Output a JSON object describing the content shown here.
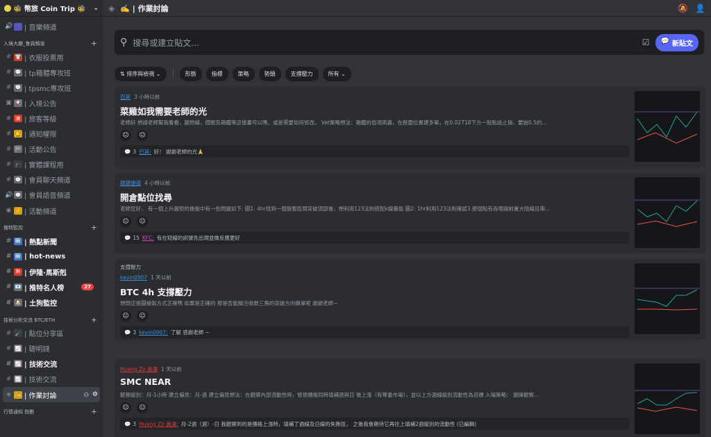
{
  "server": {
    "name": "🐝 幣旅 Coin Trip 🐝"
  },
  "channel_title": "✍️ | 作業討論",
  "sidebar": {
    "items": [
      {
        "kind": "ch",
        "icon": "speaker-icon",
        "icg": "🔊",
        "emoji": "🎵",
        "emc": "#5a4fcf",
        "label": "| 音樂頻道"
      },
      {
        "kind": "cat",
        "label": "入境大廳_會員頻道",
        "cname": "category-members"
      },
      {
        "kind": "ch",
        "icon": "hash-icon",
        "icg": "#",
        "emoji": "👕",
        "emc": "#c8412a",
        "label": "| 衣服投票用"
      },
      {
        "kind": "ch",
        "icon": "hash-icon",
        "icg": "#",
        "emoji": "💬",
        "emc": "#6d6f78",
        "label": "| tp箱體專攻班"
      },
      {
        "kind": "ch",
        "icon": "hash-icon",
        "icg": "#",
        "emoji": "💬",
        "emc": "#6d6f78",
        "label": "| tpsmc專攻班"
      },
      {
        "kind": "ch",
        "icon": "announcement-icon",
        "icg": "▣",
        "emoji": "📢",
        "emc": "#6d6f78",
        "label": "| 入境公告"
      },
      {
        "kind": "ch",
        "icon": "hash-icon",
        "icg": "#",
        "emoji": "🈵",
        "emc": "#c8412a",
        "label": "| 旅客等級"
      },
      {
        "kind": "ch",
        "icon": "hash-icon",
        "icg": "#",
        "emoji": "🔔",
        "emc": "#d4a017",
        "label": "| 通知權限"
      },
      {
        "kind": "ch",
        "icon": "hash-icon",
        "icg": "#",
        "emoji": "🏁",
        "emc": "#6d6f78",
        "label": "| 活動公告"
      },
      {
        "kind": "ch",
        "icon": "hash-icon",
        "icg": "#",
        "emoji": "🎓",
        "emc": "#3b3d44",
        "label": "| 實體課程用"
      },
      {
        "kind": "ch",
        "icon": "hash-icon",
        "icg": "#",
        "emoji": "💬",
        "emc": "#6d6f78",
        "label": "| 會員聊天頻道"
      },
      {
        "kind": "ch",
        "icon": "speaker-icon",
        "icg": "🔊",
        "emoji": "💬",
        "emc": "#6d6f78",
        "label": "| 會員語音頻道"
      },
      {
        "kind": "ch",
        "icon": "stage-icon",
        "icg": "◉",
        "emoji": "✌️",
        "emc": "#d4a017",
        "label": "| 活動頻道"
      },
      {
        "kind": "cat",
        "label": "推特監控",
        "cname": "category-twitter"
      },
      {
        "kind": "ch",
        "icon": "hash-icon",
        "icg": "#",
        "emoji": "🆕",
        "emc": "#3b6fd4",
        "label": "| 熱點新聞",
        "bold": true
      },
      {
        "kind": "ch",
        "icon": "hash-icon",
        "icg": "#",
        "emoji": "🆕",
        "emc": "#3b6fd4",
        "label": "| hot-news",
        "bold": true
      },
      {
        "kind": "ch",
        "icon": "hash-icon",
        "icg": "#",
        "emoji": "🈹",
        "emc": "#c8412a",
        "label": "| 伊隆·馬斯剋",
        "bold": true
      },
      {
        "kind": "ch",
        "icon": "hash-icon",
        "icg": "#",
        "emoji": "📧",
        "emc": "#6d6f78",
        "label": "| 推特名人榜",
        "bold": true,
        "badge": "27"
      },
      {
        "kind": "ch",
        "icon": "hash-icon",
        "icg": "#",
        "emoji": "🐶",
        "emc": "#6d6f78",
        "label": "| 土狗監控",
        "bold": true
      },
      {
        "kind": "cat",
        "label": "技術分析交流 BTC/ETH",
        "cname": "category-ta"
      },
      {
        "kind": "ch",
        "icon": "hash-icon",
        "icg": "#",
        "emoji": "🖌️",
        "emc": "#3b3d44",
        "label": "| 點位分享區"
      },
      {
        "kind": "ch",
        "icon": "hash-icon",
        "icg": "#",
        "emoji": "📈",
        "emc": "#6d6f78",
        "label": "| 聰明錢"
      },
      {
        "kind": "ch",
        "icon": "hash-icon",
        "icg": "#",
        "emoji": "📈",
        "emc": "#6d6f78",
        "label": "| 技術交流",
        "bold": true
      },
      {
        "kind": "ch",
        "icon": "hash-icon",
        "icg": "#",
        "emoji": "📈",
        "emc": "#6d6f78",
        "label": "| 技術交流"
      },
      {
        "kind": "ch",
        "icon": "forum-icon",
        "icg": "◈",
        "emoji": "✍️",
        "emc": "#d4a017",
        "label": "| 作業討論",
        "active": true
      },
      {
        "kind": "cat",
        "label": "行情通知 指數",
        "cname": "category-market"
      }
    ]
  },
  "search": {
    "placeholder": "搜尋或建立貼文..."
  },
  "new_post_label": "新貼文",
  "filters": {
    "sort": "排序與檢視",
    "tags": [
      "形態",
      "指標",
      "策略",
      "勢頭",
      "支撐壓力"
    ],
    "all": "所有"
  },
  "posts": [
    {
      "tag": "",
      "author": "巴其",
      "time": "3 小時以前",
      "title": "菜雞如我需要老師的光",
      "preview": "老師好 想請老師幫我看看，趨勢線，撐壓及箱體等這樣畫可以嗎，或是需要如何修改。 Vet策略想法：箱體的低項高識，在壓圍位置建多單，在0.02718下方一點點設止損，要說0.5的...",
      "reactions": [
        "😐",
        "😐"
      ],
      "count": "3",
      "reply_author": "巴其:",
      "reply": "好！ 謝謝老師的光🙏",
      "author_color": "#3d8fd6",
      "reply_color": "#3d8fd6"
    },
    {
      "tag": "",
      "author": "鏢鏢捷德",
      "time": "4 小時以前",
      "title": "開倉點位找尋",
      "preview": "老師您好， 有一個上升趨勢的後盤中有一些問題如下: 圖1: 4hr找到一個盤整區間突破頂部後，想利用123法則搭配k線量能 圖2: 1hr利用123法則確認3.那個點有吞噬線前置大陰線且帶...",
      "reactions": [
        "😐",
        "😐"
      ],
      "count": "15",
      "reply_author": "KFC:",
      "reply": "有在短線的訊號先出現並做反應更好",
      "author_color": "#3d8fd6",
      "reply_color": "#d946c7"
    },
    {
      "tag": "支撐壓力",
      "author": "kevin0907",
      "time": "1 天以前",
      "title": "BTC 4h 支撐壓力",
      "preview": "想問這張圖繪製方式正確嗎 如果是正確的 那是否能關注收斂三角的突破方向做單呢 謝謝老師~",
      "reactions": [
        "😐",
        "😐"
      ],
      "count": "3",
      "reply_author": "kevin0907:",
      "reply": "了解 感謝老師 ~",
      "author_color": "#3d8fd6",
      "reply_color": "#3d8fd6"
    },
    {
      "tag": "",
      "author": "Huang Zo 黃澤",
      "time": "1 天以前",
      "title": "SMC NEAR",
      "preview": "觀察級別：月-1小時 建立偏見：月-週 建立偏見想法：在觀察內部流動性時，發現價格同時填補週與日 後上漲（有尊重市場），並以上方週線級別流動性為目標 入場策略： 選擇觀察...",
      "reactions": [
        "😐",
        "😐"
      ],
      "count": "3",
      "reply_author": "Huang Zo 黃澤:",
      "reply": "月-2週（週）-日 我觀察到的是價格上漲時，填補了週線及日線的失衡區， 之後我會期待它再往上填補2週級別的流動性 (已編輯)",
      "author_color": "#e03b3b",
      "reply_color": "#e03b3b"
    }
  ]
}
